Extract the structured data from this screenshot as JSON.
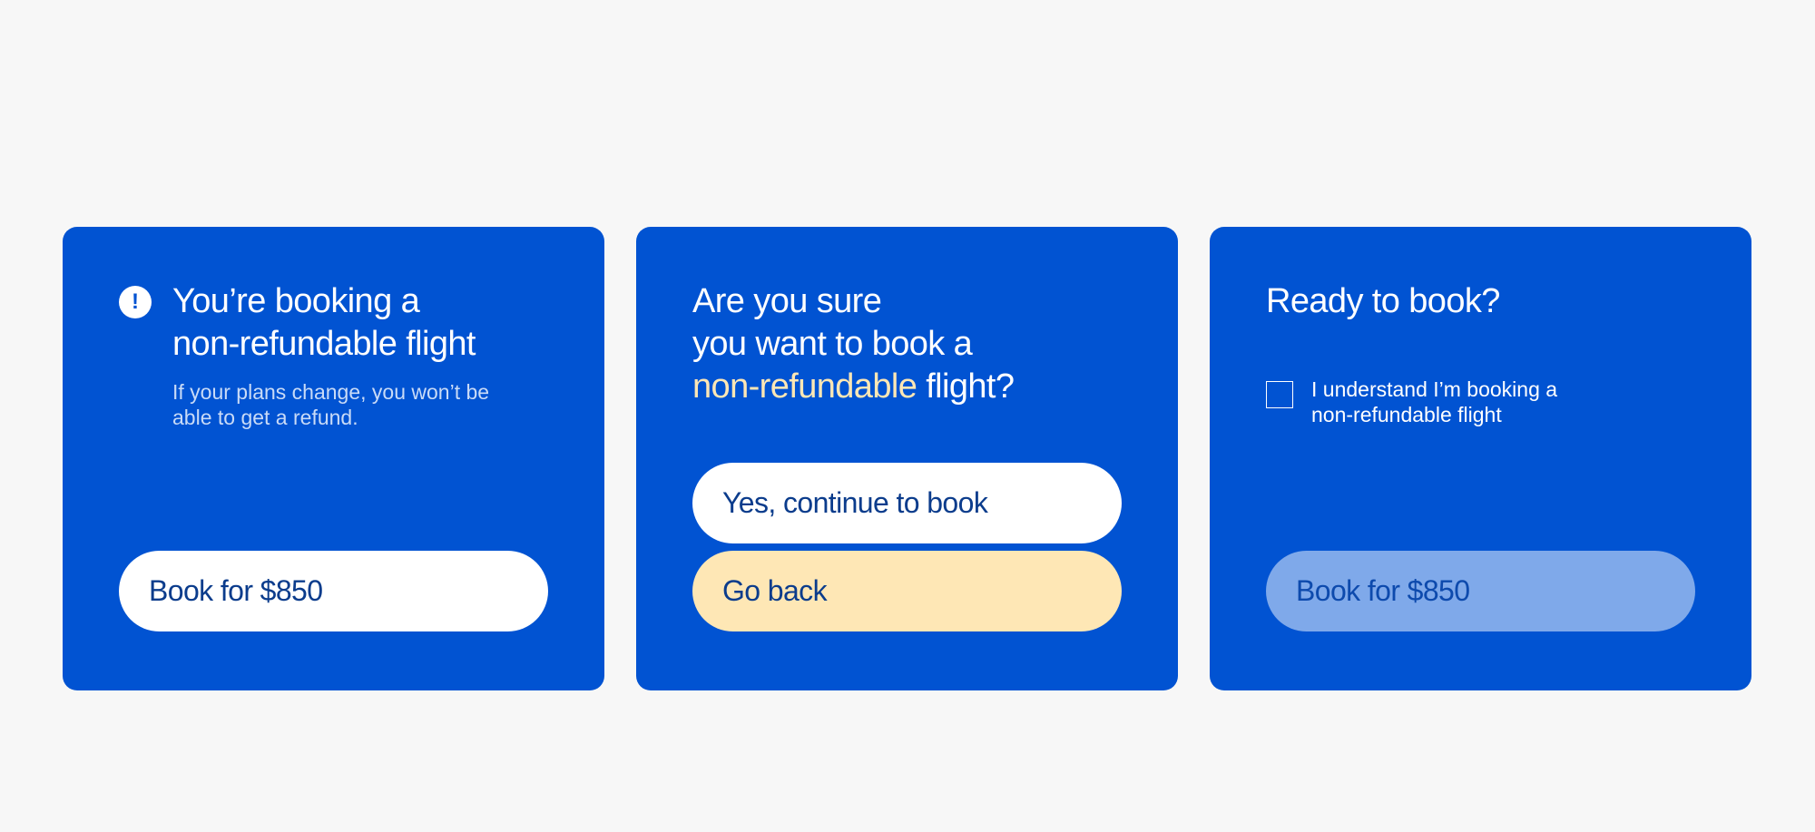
{
  "colors": {
    "page_background": "#f7f7f7",
    "card_background": "#0153d2",
    "accent_peach": "#fee7b5",
    "button_text": "#0b3c8c",
    "disabled_button": "#7fa9ea"
  },
  "card_warning": {
    "icon": "exclamation-circle-icon",
    "icon_glyph": "!",
    "title_line1": "You’re booking a",
    "title_line2": "non-refundable flight",
    "subtext_line1": "If your plans change, you won’t be",
    "subtext_line2": "able to get a refund.",
    "book_button_label": "Book for $850"
  },
  "card_confirm": {
    "title_line1": "Are you sure",
    "title_line2": "you want to book a",
    "title_line3_accent": "non-refundable",
    "title_line3_rest": " flight?",
    "yes_button_label": "Yes, continue to book",
    "back_button_label": "Go back"
  },
  "card_checkbox": {
    "title": "Ready to book?",
    "checkbox_checked": false,
    "checkbox_label_line1": "I understand I’m booking a",
    "checkbox_label_line2": "non-refundable flight",
    "book_button_label": "Book for $850",
    "book_button_disabled": true
  }
}
